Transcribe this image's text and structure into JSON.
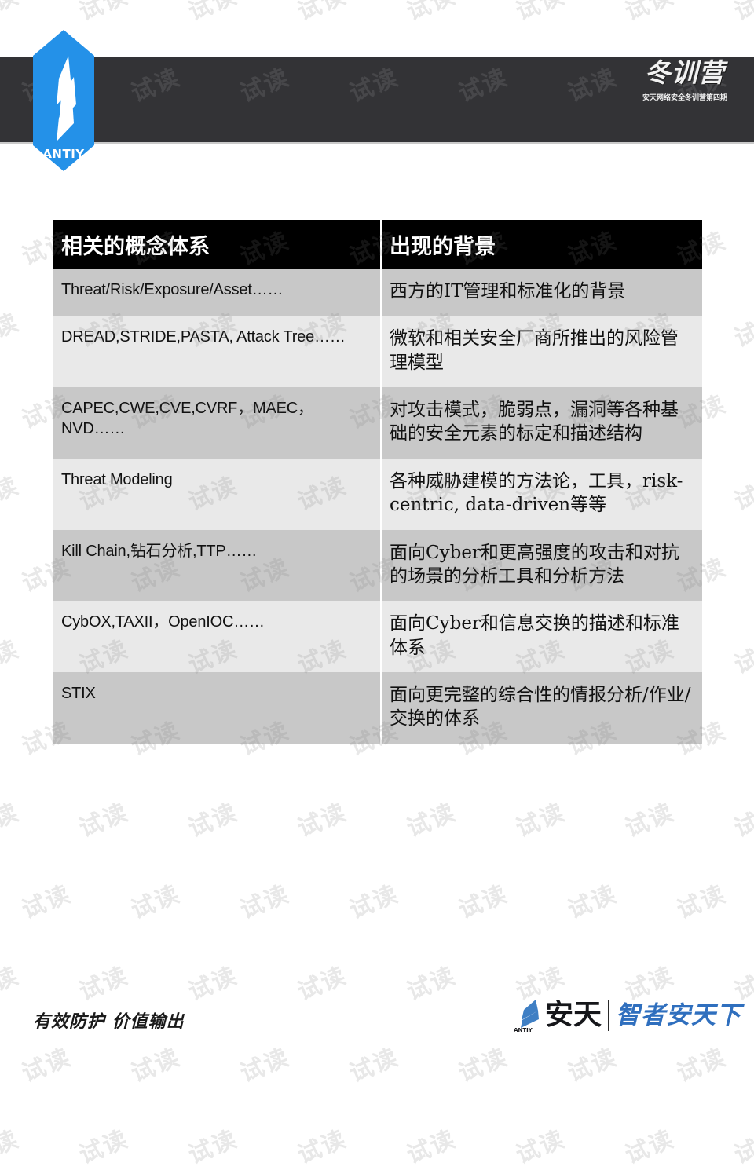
{
  "brand": {
    "logo_text": "ANTIY",
    "logo_icon": "antiy-feather-hex-logo"
  },
  "header": {
    "course_title": "冬训营",
    "course_subtitle": "安天网络安全冬训营第四期"
  },
  "watermark": {
    "text": "试读"
  },
  "table": {
    "columns": [
      "相关的概念体系",
      "出现的背景"
    ],
    "rows": [
      {
        "concept": "Threat/Risk/Exposure/Asset……",
        "background": "西方的IT管理和标准化的背景"
      },
      {
        "concept": "DREAD,STRIDE,PASTA, Attack Tree……",
        "background": "微软和相关安全厂商所推出的风险管理模型"
      },
      {
        "concept": "CAPEC,CWE,CVE,CVRF，MAEC，NVD……",
        "background": "对攻击模式，脆弱点，漏洞等各种基础的安全元素的标定和描述结构"
      },
      {
        "concept": "Threat Modeling",
        "background": "各种威胁建模的方法论，工具，risk-centric, data-driven等等"
      },
      {
        "concept": "Kill Chain,钻石分析,TTP……",
        "background": "面向Cyber和更高强度的攻击和对抗的场景的分析工具和分析方法"
      },
      {
        "concept": "CybOX,TAXII，OpenIOC……",
        "background": "面向Cyber和信息交换的描述和标准体系"
      },
      {
        "concept": "STIX",
        "background": "面向更完整的综合性的情报分析/作业/交换的体系"
      }
    ]
  },
  "footer": {
    "slogan": "有效防护 价值输出",
    "brand_cn": "安天",
    "brand_mark": "ANTIY",
    "tagline": "智者安天下"
  },
  "colors": {
    "band": "#333336",
    "accent_blue": "#2491e8",
    "header_bg": "#000000",
    "row_dark": "#c8c8c8",
    "row_light": "#e9e9e9",
    "tagline_blue": "#2f6fbe"
  }
}
